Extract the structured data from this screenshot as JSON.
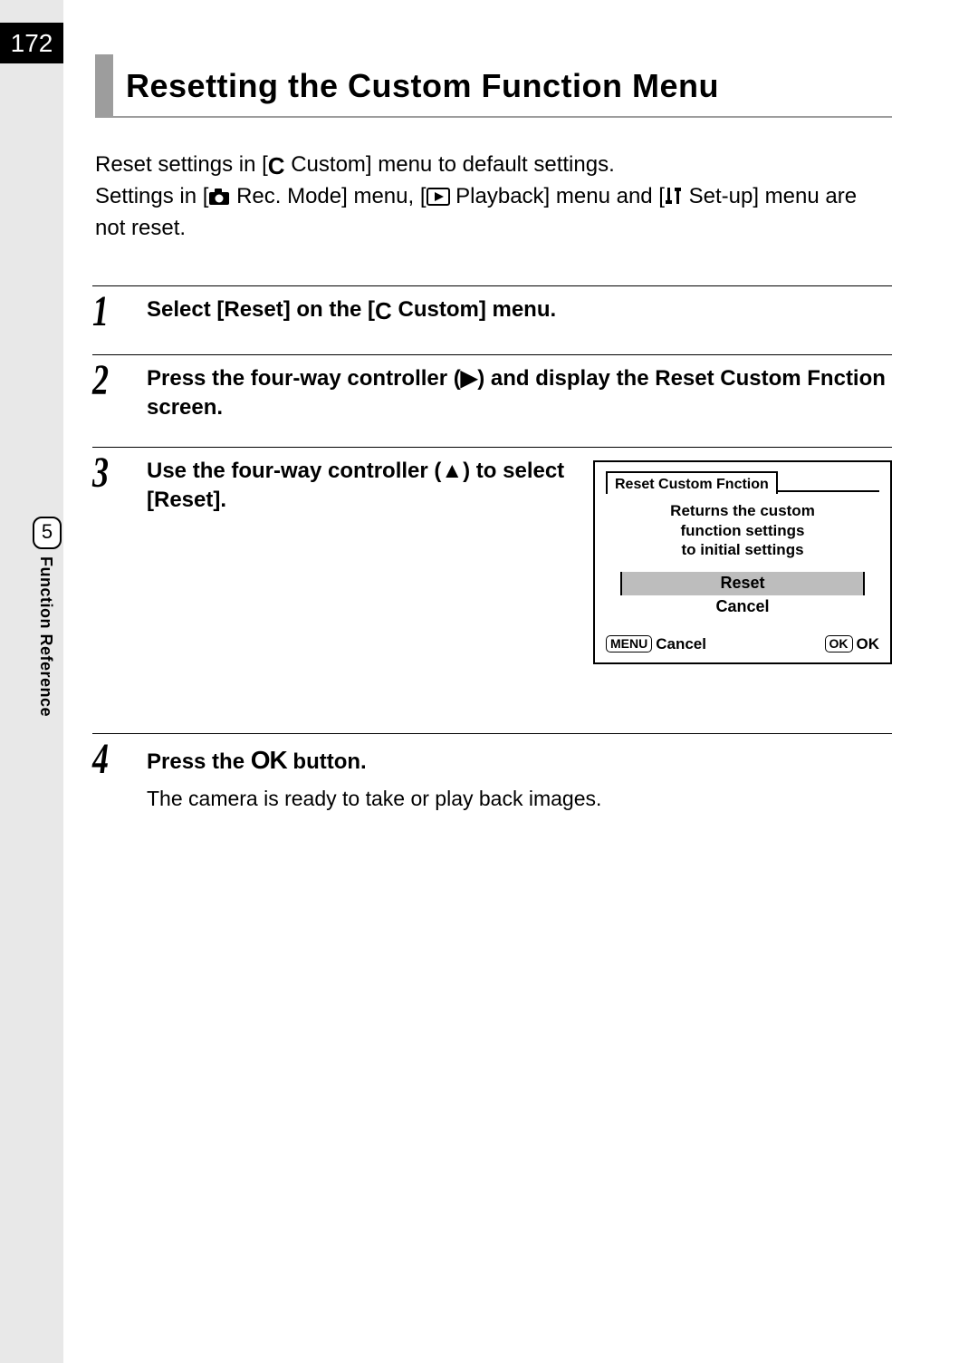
{
  "page": {
    "number": "172",
    "chapter_number": "5",
    "side_label": "Function Reference"
  },
  "title": "Resetting the Custom Function Menu",
  "intro": {
    "line1_a": "Reset settings in [",
    "line1_b": " Custom] menu to default settings.",
    "line2_a": "Settings in [",
    "line2_b": " Rec. Mode] menu, [",
    "line2_c": " Playback] menu and [",
    "line2_d": " Set-up] menu are not reset.",
    "custom_icon": "C"
  },
  "steps": [
    {
      "num": "1",
      "title_a": "Select [Reset] on the [",
      "title_b": " Custom] menu."
    },
    {
      "num": "2",
      "title": "Press the four-way controller (▶) and display the Reset Custom Fnction screen."
    },
    {
      "num": "3",
      "title": "Use the four-way controller (▲) to select [Reset]."
    },
    {
      "num": "4",
      "title_a": "Press the ",
      "title_b": " button.",
      "ok_glyph": "OK",
      "note": "The camera is ready to take or play back images."
    }
  ],
  "camera_screen": {
    "tab": "Reset Custom Fnction",
    "desc_l1": "Returns the custom",
    "desc_l2": "function settings",
    "desc_l3": "to initial settings",
    "opt_reset": "Reset",
    "opt_cancel": "Cancel",
    "footer_menu": "MENU",
    "footer_cancel": "Cancel",
    "footer_ok_pill": "OK",
    "footer_ok": "OK"
  }
}
